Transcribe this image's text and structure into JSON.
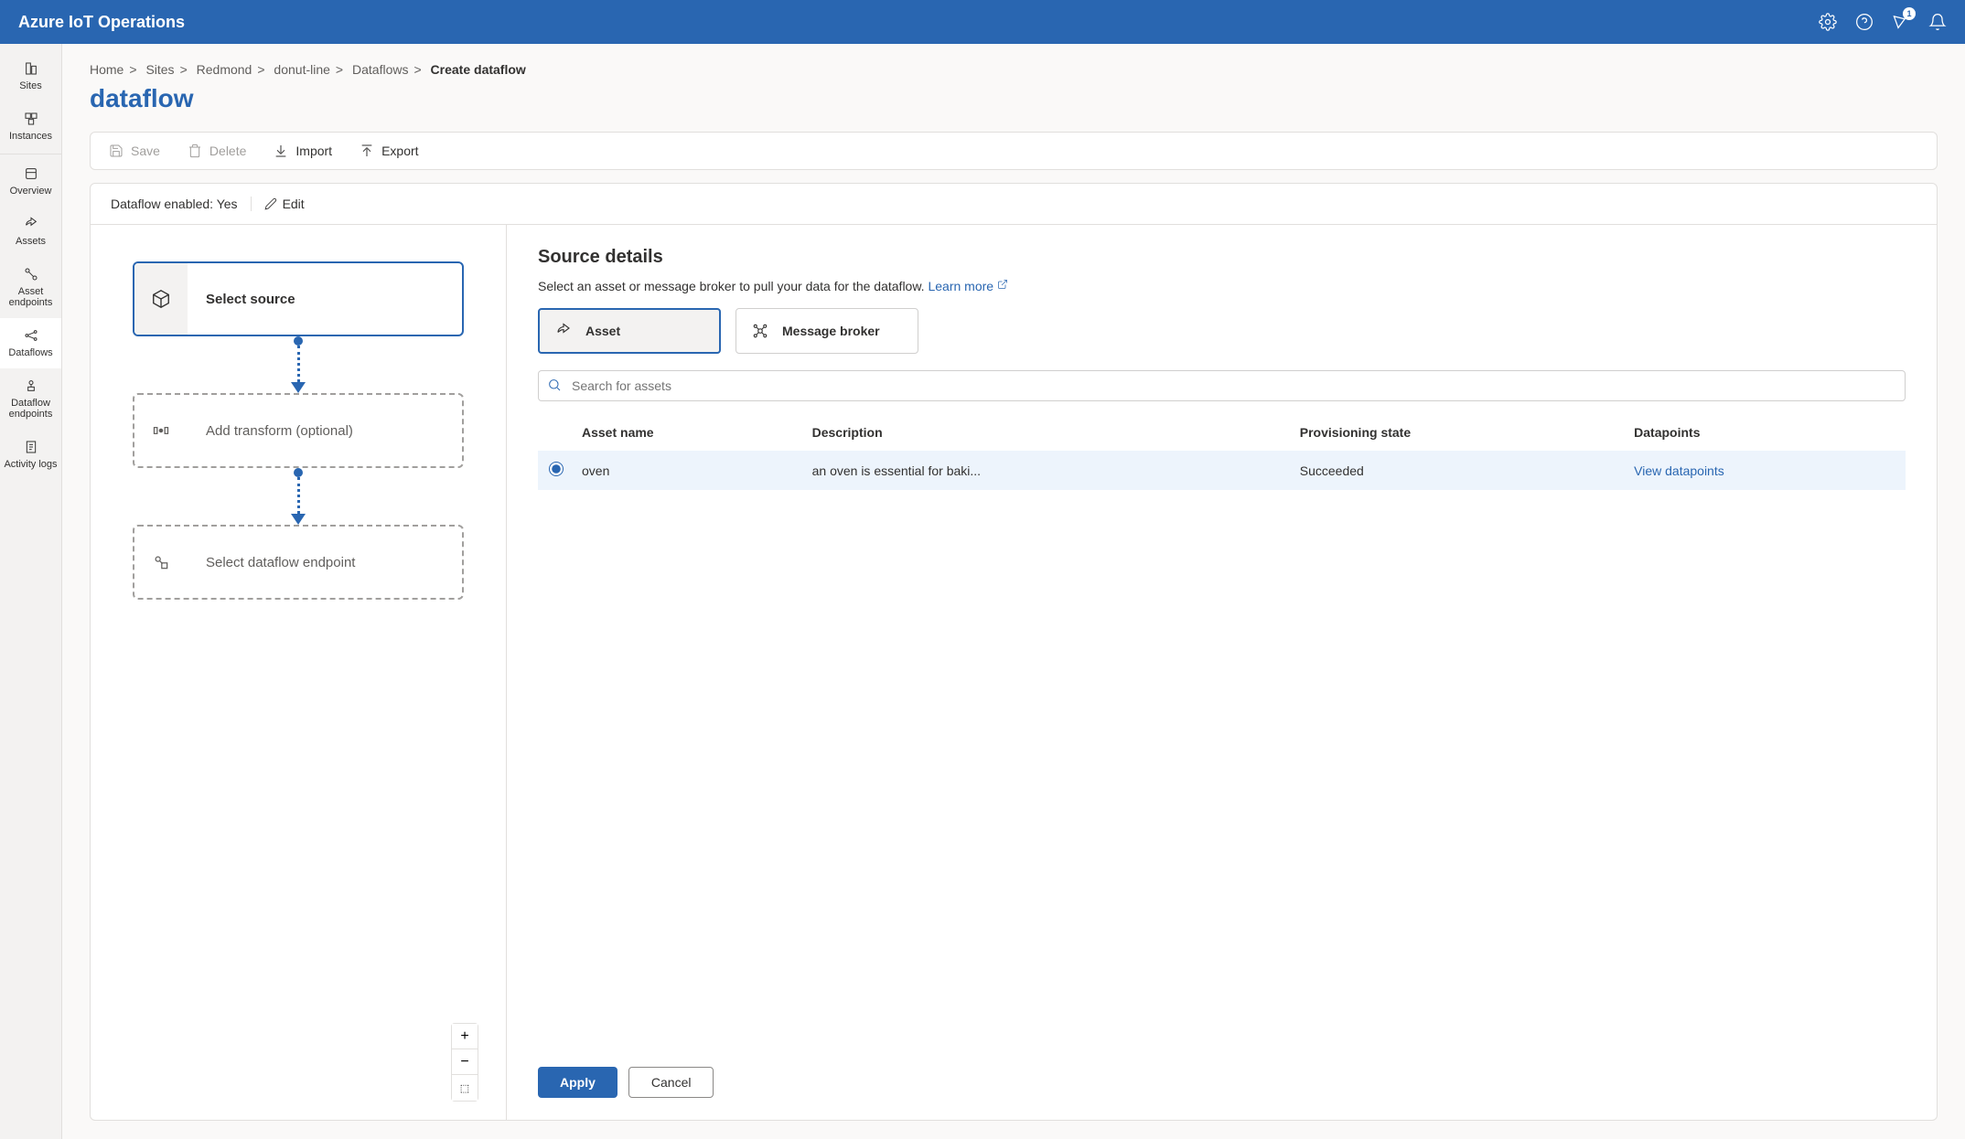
{
  "header": {
    "title": "Azure IoT Operations",
    "notification_count": "1"
  },
  "sidebar": {
    "items": [
      {
        "label": "Sites"
      },
      {
        "label": "Instances"
      },
      {
        "label": "Overview"
      },
      {
        "label": "Assets"
      },
      {
        "label": "Asset endpoints"
      },
      {
        "label": "Dataflows"
      },
      {
        "label": "Dataflow endpoints"
      },
      {
        "label": "Activity logs"
      }
    ]
  },
  "breadcrumb": {
    "items": [
      "Home",
      "Sites",
      "Redmond",
      "donut-line",
      "Dataflows"
    ],
    "current": "Create dataflow"
  },
  "page_title": "dataflow",
  "toolbar": {
    "save": "Save",
    "delete": "Delete",
    "import": "Import",
    "export": "Export"
  },
  "enabled_row": {
    "label": "Dataflow enabled: Yes",
    "edit": "Edit"
  },
  "canvas": {
    "source": "Select source",
    "transform": "Add transform (optional)",
    "endpoint": "Select dataflow endpoint"
  },
  "details": {
    "title": "Source details",
    "subtitle": "Select an asset or message broker to pull your data for the dataflow.",
    "learn_more": "Learn more",
    "type_asset": "Asset",
    "type_broker": "Message broker",
    "search_placeholder": "Search for assets",
    "columns": {
      "name": "Asset name",
      "description": "Description",
      "state": "Provisioning state",
      "datapoints": "Datapoints"
    },
    "rows": [
      {
        "name": "oven",
        "description": "an oven is essential for baki...",
        "state": "Succeeded",
        "datapoints": "View datapoints"
      }
    ],
    "apply": "Apply",
    "cancel": "Cancel"
  }
}
